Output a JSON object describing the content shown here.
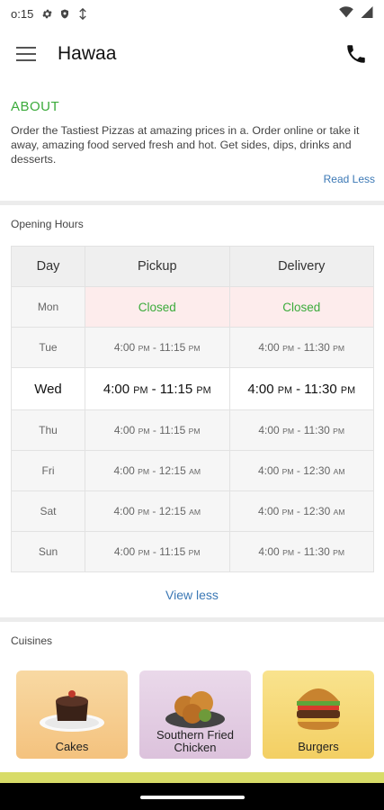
{
  "status_bar": {
    "time": "o:15"
  },
  "app_bar": {
    "title": "Hawaa"
  },
  "about": {
    "heading": "ABOUT",
    "description": "Order the Tastiest Pizzas at amazing prices in a. Order online or take it away, amazing food served fresh and hot. Get sides, dips, drinks and desserts.",
    "toggle_label": "Read Less"
  },
  "opening_hours": {
    "title": "Opening Hours",
    "headers": {
      "day": "Day",
      "pickup": "Pickup",
      "delivery": "Delivery"
    },
    "rows": [
      {
        "day": "Mon",
        "pickup": "Closed",
        "delivery": "Closed"
      },
      {
        "day": "Tue",
        "pickup_start": "4:00",
        "pickup_start_ampm": "PM",
        "pickup_end": "11:15",
        "pickup_end_ampm": "PM",
        "delivery_start": "4:00",
        "delivery_start_ampm": "PM",
        "delivery_end": "11:30",
        "delivery_end_ampm": "PM"
      },
      {
        "day": "Wed",
        "pickup_start": "4:00",
        "pickup_start_ampm": "PM",
        "pickup_end": "11:15",
        "pickup_end_ampm": "PM",
        "delivery_start": "4:00",
        "delivery_start_ampm": "PM",
        "delivery_end": "11:30",
        "delivery_end_ampm": "PM"
      },
      {
        "day": "Thu",
        "pickup_start": "4:00",
        "pickup_start_ampm": "PM",
        "pickup_end": "11:15",
        "pickup_end_ampm": "PM",
        "delivery_start": "4:00",
        "delivery_start_ampm": "PM",
        "delivery_end": "11:30",
        "delivery_end_ampm": "PM"
      },
      {
        "day": "Fri",
        "pickup_start": "4:00",
        "pickup_start_ampm": "PM",
        "pickup_end": "12:15",
        "pickup_end_ampm": "AM",
        "delivery_start": "4:00",
        "delivery_start_ampm": "PM",
        "delivery_end": "12:30",
        "delivery_end_ampm": "AM"
      },
      {
        "day": "Sat",
        "pickup_start": "4:00",
        "pickup_start_ampm": "PM",
        "pickup_end": "12:15",
        "pickup_end_ampm": "AM",
        "delivery_start": "4:00",
        "delivery_start_ampm": "PM",
        "delivery_end": "12:30",
        "delivery_end_ampm": "AM"
      },
      {
        "day": "Sun",
        "pickup_start": "4:00",
        "pickup_start_ampm": "PM",
        "pickup_end": "11:15",
        "pickup_end_ampm": "PM",
        "delivery_start": "4:00",
        "delivery_start_ampm": "PM",
        "delivery_end": "11:30",
        "delivery_end_ampm": "PM"
      }
    ],
    "toggle_label": "View less"
  },
  "cuisines": {
    "title": "Cuisines",
    "items": [
      {
        "label": "Cakes",
        "icon": "cake-icon",
        "color": "#f4c27e"
      },
      {
        "label": "Southern Fried Chicken",
        "icon": "fried-chicken-icon",
        "color": "#e3cde3"
      },
      {
        "label": "Burgers",
        "icon": "burger-icon",
        "color": "#f6d675"
      }
    ]
  },
  "colors": {
    "accent_green": "#3bab3b",
    "link_blue": "#3b78b5",
    "closed_bg": "#fdecec"
  }
}
